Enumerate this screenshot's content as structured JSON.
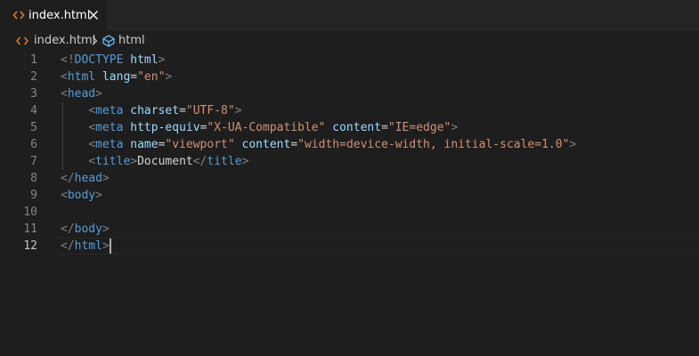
{
  "tab": {
    "label": "index.html",
    "icon": "code-file-icon",
    "close_icon": "close-icon"
  },
  "breadcrumb": {
    "file_label": "index.html",
    "symbol_label": "html"
  },
  "colors": {
    "background": "#1e1e1e",
    "tab_bar": "#252526",
    "html_icon": "#e37933",
    "tag": "#569cd6",
    "attribute": "#9cdcfe",
    "string": "#ce9178",
    "punctuation": "#808080",
    "text": "#d4d4d4",
    "line_number": "#858585"
  },
  "editor": {
    "current_line": 12,
    "lines": [
      {
        "number": "1",
        "tokens": [
          {
            "t": "punc",
            "v": "<!"
          },
          {
            "t": "tag",
            "v": "DOCTYPE"
          },
          {
            "t": "text",
            "v": " "
          },
          {
            "t": "attr",
            "v": "html"
          },
          {
            "t": "punc",
            "v": ">"
          }
        ]
      },
      {
        "number": "2",
        "tokens": [
          {
            "t": "punc",
            "v": "<"
          },
          {
            "t": "tag",
            "v": "html"
          },
          {
            "t": "text",
            "v": " "
          },
          {
            "t": "attr",
            "v": "lang"
          },
          {
            "t": "text",
            "v": "="
          },
          {
            "t": "str",
            "v": "\"en\""
          },
          {
            "t": "punc",
            "v": ">"
          }
        ]
      },
      {
        "number": "3",
        "tokens": [
          {
            "t": "punc",
            "v": "<"
          },
          {
            "t": "tag",
            "v": "head"
          },
          {
            "t": "punc",
            "v": ">"
          }
        ]
      },
      {
        "number": "4",
        "tokens": [
          {
            "t": "text",
            "v": "    "
          },
          {
            "t": "punc",
            "v": "<"
          },
          {
            "t": "tag",
            "v": "meta"
          },
          {
            "t": "text",
            "v": " "
          },
          {
            "t": "attr",
            "v": "charset"
          },
          {
            "t": "text",
            "v": "="
          },
          {
            "t": "str",
            "v": "\"UTF-8\""
          },
          {
            "t": "punc",
            "v": ">"
          }
        ]
      },
      {
        "number": "5",
        "tokens": [
          {
            "t": "text",
            "v": "    "
          },
          {
            "t": "punc",
            "v": "<"
          },
          {
            "t": "tag",
            "v": "meta"
          },
          {
            "t": "text",
            "v": " "
          },
          {
            "t": "attr",
            "v": "http-equiv"
          },
          {
            "t": "text",
            "v": "="
          },
          {
            "t": "str",
            "v": "\"X-UA-Compatible\""
          },
          {
            "t": "text",
            "v": " "
          },
          {
            "t": "attr",
            "v": "content"
          },
          {
            "t": "text",
            "v": "="
          },
          {
            "t": "str",
            "v": "\"IE=edge\""
          },
          {
            "t": "punc",
            "v": ">"
          }
        ]
      },
      {
        "number": "6",
        "tokens": [
          {
            "t": "text",
            "v": "    "
          },
          {
            "t": "punc",
            "v": "<"
          },
          {
            "t": "tag",
            "v": "meta"
          },
          {
            "t": "text",
            "v": " "
          },
          {
            "t": "attr",
            "v": "name"
          },
          {
            "t": "text",
            "v": "="
          },
          {
            "t": "str",
            "v": "\"viewport\""
          },
          {
            "t": "text",
            "v": " "
          },
          {
            "t": "attr",
            "v": "content"
          },
          {
            "t": "text",
            "v": "="
          },
          {
            "t": "str",
            "v": "\"width=device-width, initial-scale=1.0\""
          },
          {
            "t": "punc",
            "v": ">"
          }
        ]
      },
      {
        "number": "7",
        "tokens": [
          {
            "t": "text",
            "v": "    "
          },
          {
            "t": "punc",
            "v": "<"
          },
          {
            "t": "tag",
            "v": "title"
          },
          {
            "t": "punc",
            "v": ">"
          },
          {
            "t": "text",
            "v": "Document"
          },
          {
            "t": "punc",
            "v": "</"
          },
          {
            "t": "tag",
            "v": "title"
          },
          {
            "t": "punc",
            "v": ">"
          }
        ]
      },
      {
        "number": "8",
        "tokens": [
          {
            "t": "punc",
            "v": "</"
          },
          {
            "t": "tag",
            "v": "head"
          },
          {
            "t": "punc",
            "v": ">"
          }
        ]
      },
      {
        "number": "9",
        "tokens": [
          {
            "t": "punc",
            "v": "<"
          },
          {
            "t": "tag",
            "v": "body"
          },
          {
            "t": "punc",
            "v": ">"
          }
        ]
      },
      {
        "number": "10",
        "tokens": []
      },
      {
        "number": "11",
        "tokens": [
          {
            "t": "punc",
            "v": "</"
          },
          {
            "t": "tag",
            "v": "body"
          },
          {
            "t": "punc",
            "v": ">"
          }
        ]
      },
      {
        "number": "12",
        "tokens": [
          {
            "t": "punc",
            "v": "</"
          },
          {
            "t": "tag",
            "v": "html"
          },
          {
            "t": "punc",
            "v": ">"
          }
        ]
      }
    ]
  }
}
